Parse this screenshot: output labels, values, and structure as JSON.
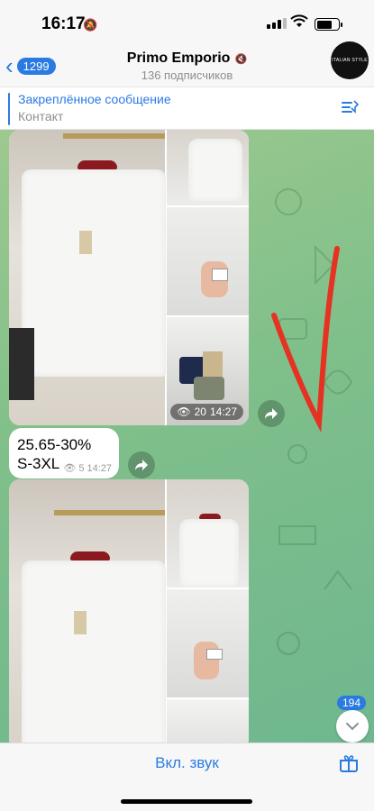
{
  "status": {
    "time": "16:17"
  },
  "header": {
    "back_count": "1299",
    "title": "Primo Emporio",
    "subscribers": "136 подписчиков",
    "avatar_text": "ITALIAN STYLE"
  },
  "pinned": {
    "title": "Закреплённое сообщение",
    "text": "Контакт"
  },
  "messages": {
    "album1_views": "20",
    "album1_time": "14:27",
    "text_line1": "25.65-30%",
    "text_line2": "S-3XL",
    "text_views": "5",
    "text_time": "14:27"
  },
  "scroll_badge": "194",
  "bottom": {
    "sound_label": "Вкл. звук"
  },
  "colors": {
    "accent": "#2a7ae2",
    "chat_bg": "#8cc48c",
    "annotation": "#e53222"
  }
}
